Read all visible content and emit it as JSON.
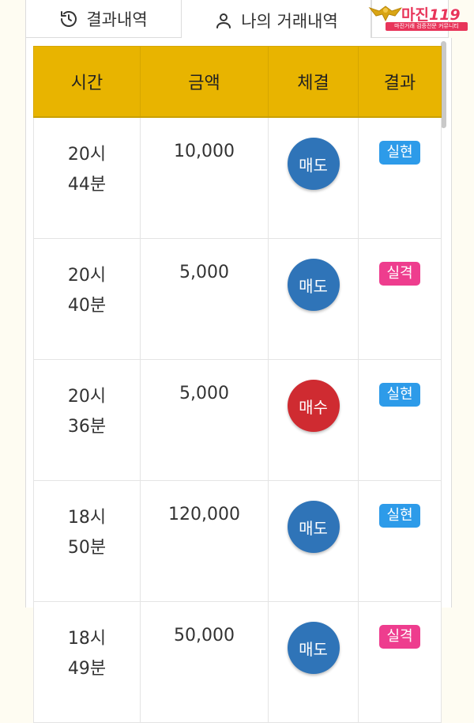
{
  "tabs": {
    "results_label": "결과내역",
    "my_trades_label": "나의 거래내역"
  },
  "logo": {
    "name": "마진",
    "suffix": "119",
    "tagline": "마진거래 검증전문 커뮤니티"
  },
  "colors": {
    "header_bg": "#e8b400",
    "sell": "#2f74b8",
    "buy": "#cf2b31",
    "realized": "#2d9be9",
    "failed": "#ee3d8e"
  },
  "table": {
    "headers": [
      "시간",
      "금액",
      "체결",
      "결과"
    ],
    "rows": [
      {
        "hour": "20시",
        "minute": "44분",
        "amount": "10,000",
        "trade": "매도",
        "trade_type": "sell",
        "result": "실현",
        "result_type": "gain"
      },
      {
        "hour": "20시",
        "minute": "40분",
        "amount": "5,000",
        "trade": "매도",
        "trade_type": "sell",
        "result": "실격",
        "result_type": "loss"
      },
      {
        "hour": "20시",
        "minute": "36분",
        "amount": "5,000",
        "trade": "매수",
        "trade_type": "buy",
        "result": "실현",
        "result_type": "gain"
      },
      {
        "hour": "18시",
        "minute": "50분",
        "amount": "120,000",
        "trade": "매도",
        "trade_type": "sell",
        "result": "실현",
        "result_type": "gain"
      },
      {
        "hour": "18시",
        "minute": "49분",
        "amount": "50,000",
        "trade": "매도",
        "trade_type": "sell",
        "result": "실격",
        "result_type": "loss"
      }
    ]
  }
}
